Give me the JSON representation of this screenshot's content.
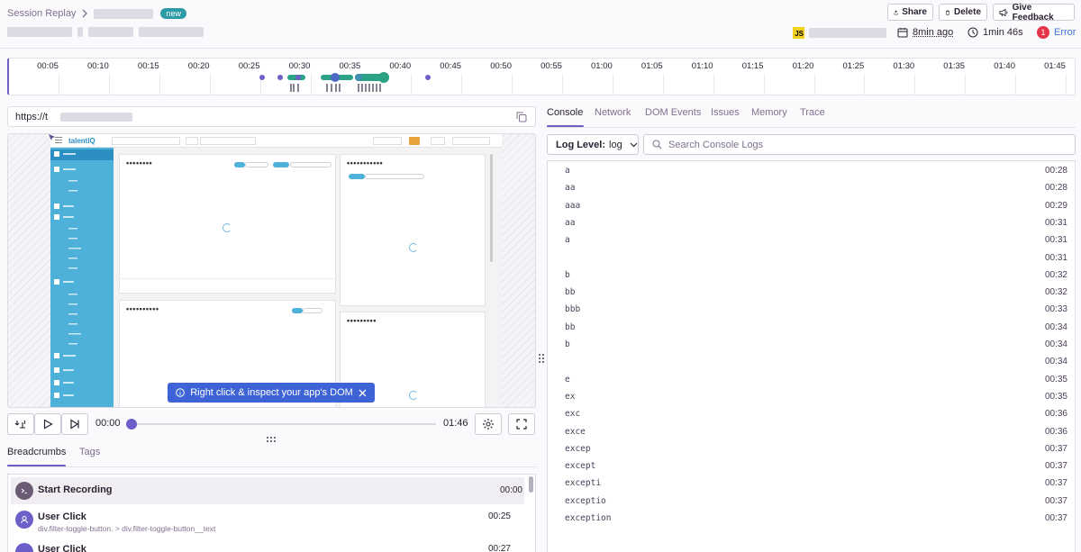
{
  "header": {
    "breadcrumb_root": "Session Replay",
    "badge": "new",
    "share_label": "Share",
    "delete_label": "Delete",
    "feedback_label": "Give Feedback",
    "js_badge": "JS",
    "time_ago": "8min ago",
    "duration": "1min 46s",
    "error_count": "1",
    "error_label": "Error"
  },
  "timeline": {
    "ticks": [
      "00:05",
      "00:10",
      "00:15",
      "00:20",
      "00:25",
      "00:30",
      "00:35",
      "00:40",
      "00:45",
      "00:50",
      "00:55",
      "01:00",
      "01:05",
      "01:10",
      "01:15",
      "01:20",
      "01:25",
      "01:30",
      "01:35",
      "01:40",
      "01:45"
    ]
  },
  "url": {
    "prefix": "https://t"
  },
  "replay_app": {
    "brand": "talentiQ"
  },
  "tooltip": {
    "text": "Right click & inspect your app's DOM"
  },
  "player": {
    "current": "00:00",
    "total": "01:46",
    "progress": 0
  },
  "bottom_tabs": {
    "breadcrumbs": "Breadcrumbs",
    "tags": "Tags"
  },
  "breadcrumbs": [
    {
      "title": "Start Recording",
      "sub": "",
      "time": "00:00",
      "kind": "start"
    },
    {
      "title": "User Click",
      "sub": "div.filter-toggle-button. > div.filter-toggle-button__text",
      "time": "00:25",
      "kind": "click"
    },
    {
      "title": "User Click",
      "sub": "",
      "time": "00:27",
      "kind": "click"
    }
  ],
  "right_tabs": [
    "Console",
    "Network",
    "DOM Events",
    "Issues",
    "Memory",
    "Trace"
  ],
  "console": {
    "log_level_label": "Log Level:",
    "log_level_value": "log",
    "search_placeholder": "Search Console Logs",
    "rows": [
      {
        "msg": "a",
        "time": "00:28"
      },
      {
        "msg": "aa",
        "time": "00:28"
      },
      {
        "msg": "aaa",
        "time": "00:29"
      },
      {
        "msg": "aa",
        "time": "00:31"
      },
      {
        "msg": "a",
        "time": "00:31"
      },
      {
        "msg": "",
        "time": "00:31"
      },
      {
        "msg": "b",
        "time": "00:32"
      },
      {
        "msg": "bb",
        "time": "00:32"
      },
      {
        "msg": "bbb",
        "time": "00:33"
      },
      {
        "msg": "bb",
        "time": "00:34"
      },
      {
        "msg": "b",
        "time": "00:34"
      },
      {
        "msg": "",
        "time": "00:34"
      },
      {
        "msg": "e",
        "time": "00:35"
      },
      {
        "msg": "ex",
        "time": "00:35"
      },
      {
        "msg": "exc",
        "time": "00:36"
      },
      {
        "msg": "exce",
        "time": "00:36"
      },
      {
        "msg": "excep",
        "time": "00:37"
      },
      {
        "msg": "except",
        "time": "00:37"
      },
      {
        "msg": "excepti",
        "time": "00:37"
      },
      {
        "msg": "exceptio",
        "time": "00:37"
      },
      {
        "msg": "exception",
        "time": "00:37"
      }
    ]
  },
  "colors": {
    "accent": "#6c5fc7",
    "error": "#e6344b",
    "tooltip": "#3e63d6",
    "app_sidebar": "#4eb1d9",
    "timeline_green": "#2ba185"
  }
}
